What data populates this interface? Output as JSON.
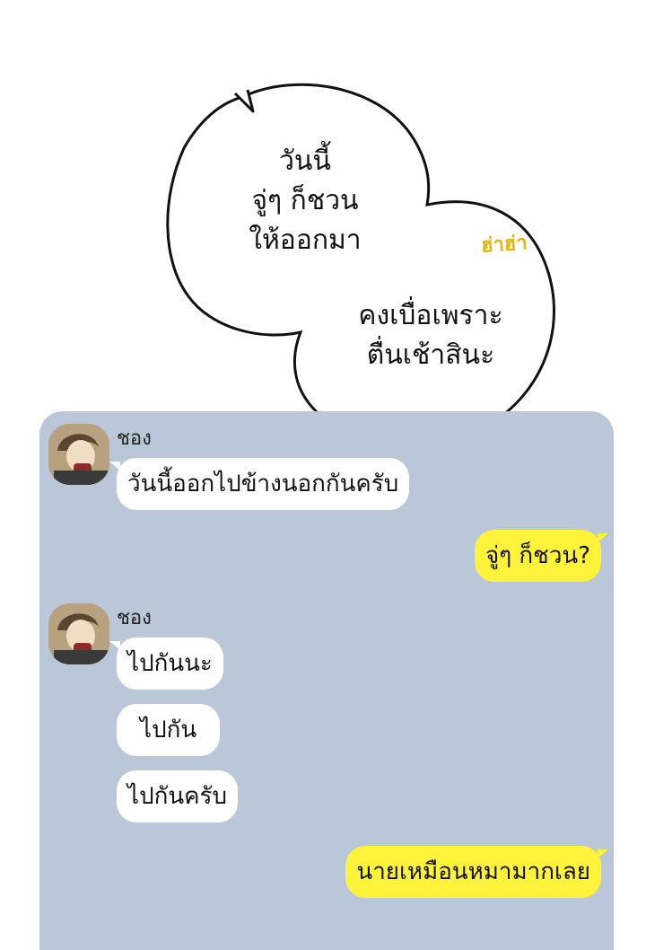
{
  "thought": {
    "lines_left": [
      "วันนี้",
      "จู่ๆ ก็ชวน",
      "ให้ออกมา"
    ],
    "lines_right": [
      "คงเบื่อเพราะ",
      "ตื่นเช้าสินะ"
    ],
    "sfx": "ฮ่าฮ่า"
  },
  "chat": {
    "messages": [
      {
        "sender": "ชอง",
        "text": "วันนี้ออกไปข้างนอกกันครับ"
      },
      {
        "text": "จู่ๆ ก็ชวน?"
      },
      {
        "sender": "ชอง",
        "text": "ไปกันนะ"
      },
      {
        "text": "ไปกัน"
      },
      {
        "text": "ไปกันครับ"
      },
      {
        "text": "นายเหมือนหมามากเลย"
      }
    ]
  },
  "colors": {
    "chat_background": "#b9c7d9",
    "outgoing_bubble": "#fff23a",
    "incoming_bubble": "#ffffff",
    "sfx": "#e6b400"
  }
}
